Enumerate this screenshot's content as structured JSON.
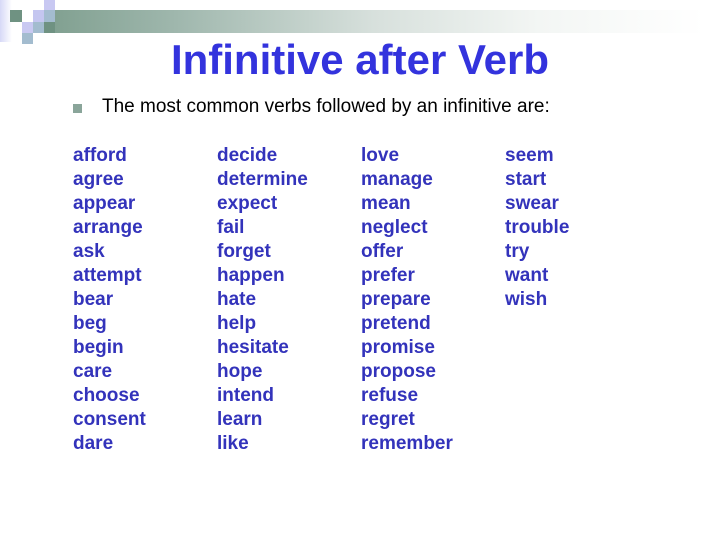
{
  "slide": {
    "title": "Infinitive after Verb",
    "bullet_text": "The most common verbs followed by an infinitive are:",
    "colors": {
      "title": "#3333dd",
      "verbs": "#3333bb",
      "bullet": "#8aa59a",
      "bar_start": "#7f9f8f"
    }
  },
  "verb_columns": [
    {
      "items": [
        "afford",
        "agree",
        "appear",
        "arrange",
        "ask",
        "attempt",
        "bear",
        "beg",
        "begin",
        "care",
        "choose",
        "consent",
        "dare"
      ]
    },
    {
      "items": [
        "decide",
        "determine",
        "expect",
        "fail",
        "forget",
        "happen",
        "hate",
        "help",
        "hesitate",
        "hope",
        "intend",
        "learn",
        "like"
      ]
    },
    {
      "items": [
        "love",
        "manage",
        "mean",
        "neglect",
        "offer",
        "prefer",
        "prepare",
        "pretend",
        "promise",
        "propose",
        "refuse",
        "regret",
        "remember"
      ]
    },
    {
      "items": [
        "seem",
        "start",
        "swear",
        "trouble",
        "try",
        "want",
        "wish"
      ]
    }
  ]
}
